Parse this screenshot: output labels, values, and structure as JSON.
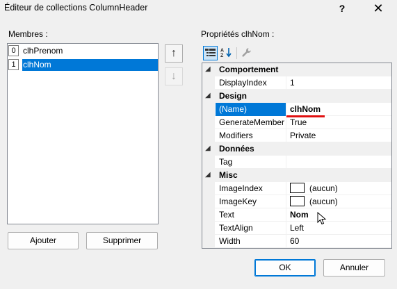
{
  "window": {
    "title": "Éditeur de collections ColumnHeader",
    "help_glyph": "?",
    "close_glyph": "✕"
  },
  "members": {
    "label": "Membres :",
    "items": [
      {
        "index": "0",
        "name": "clhPrenom"
      },
      {
        "index": "1",
        "name": "clhNom"
      }
    ],
    "selected_index": 1,
    "move_up_glyph": "↑",
    "move_down_glyph": "↓"
  },
  "buttons": {
    "add": "Ajouter",
    "remove": "Supprimer",
    "ok": "OK",
    "cancel": "Annuler"
  },
  "properties": {
    "label": "Propriétés clhNom :",
    "toolbar": {
      "categorized_icon": "categorized-view-icon",
      "alphabetical_icon": "alphabetical-sort-icon",
      "property_pages_icon": "wrench-icon"
    },
    "categories": [
      {
        "name": "Comportement",
        "toggle": "◢",
        "rows": [
          {
            "name": "DisplayIndex",
            "value": "1"
          }
        ]
      },
      {
        "name": "Design",
        "toggle": "◢",
        "rows": [
          {
            "name": "(Name)",
            "value": "clhNom"
          },
          {
            "name": "GenerateMember",
            "value": "True"
          },
          {
            "name": "Modifiers",
            "value": "Private"
          }
        ]
      },
      {
        "name": "Données",
        "toggle": "◢",
        "rows": [
          {
            "name": "Tag",
            "value": ""
          }
        ]
      },
      {
        "name": "Misc",
        "toggle": "◢",
        "rows": [
          {
            "name": "ImageIndex",
            "value": "(aucun)"
          },
          {
            "name": "ImageKey",
            "value": "(aucun)"
          },
          {
            "name": "Text",
            "value": "Nom"
          },
          {
            "name": "TextAlign",
            "value": "Left"
          },
          {
            "name": "Width",
            "value": "60"
          }
        ]
      }
    ]
  },
  "colors": {
    "selection": "#0078d7",
    "annotation_underline": "#e01010"
  }
}
